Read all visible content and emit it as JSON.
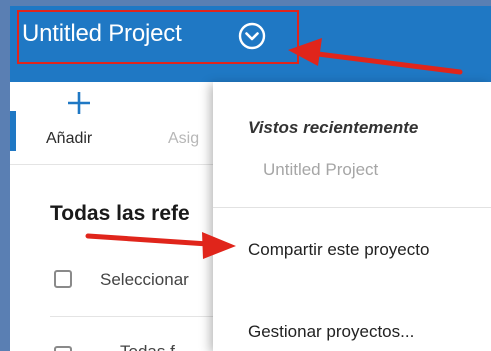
{
  "header": {
    "project_title": "Untitled Project"
  },
  "toolbar": {
    "add_label": "Añadir",
    "assign_label": "Asig"
  },
  "main": {
    "section_title": "Todas las refe",
    "select_label": "Seleccionar",
    "next_row_text": "Todas f"
  },
  "dropdown": {
    "recent_heading": "Vistos recientemente",
    "recent_items": [
      "Untitled Project"
    ],
    "share_label": "Compartir este proyecto",
    "manage_label": "Gestionar proyectos..."
  },
  "colors": {
    "header_bg": "#1f78c4",
    "annotation_red": "#e0251b",
    "outer_bg": "#5a7fb3"
  },
  "icons": {
    "dropdown_toggle": "chevron-down-circle-icon",
    "add": "plus-icon"
  }
}
